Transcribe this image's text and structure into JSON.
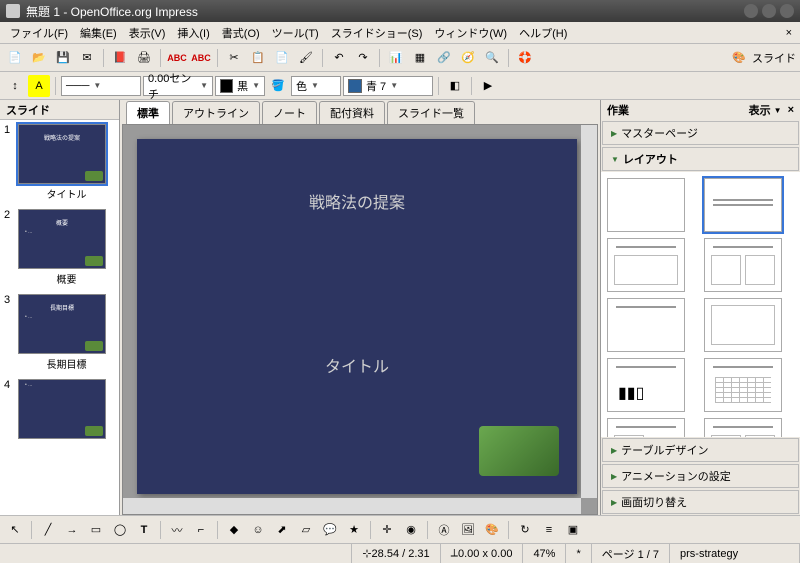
{
  "window": {
    "title": "無題 1 - OpenOffice.org Impress"
  },
  "menus": {
    "file": "ファイル(F)",
    "edit": "編集(E)",
    "view": "表示(V)",
    "insert": "挿入(I)",
    "format": "書式(O)",
    "tools": "ツール(T)",
    "slideshow": "スライドショー(S)",
    "window": "ウィンドウ(W)",
    "help": "ヘルプ(H)"
  },
  "toolbar2": {
    "line_width": "0.00センチ",
    "color1_label": "黒",
    "color2_label": "色",
    "color3_label": "青 7"
  },
  "slide_toggle": "スライド",
  "slide_panel": {
    "title": "スライド"
  },
  "slides": [
    {
      "num": "1",
      "label": "タイトル",
      "title": "戦略法の提案"
    },
    {
      "num": "2",
      "label": "概要",
      "title": "概要"
    },
    {
      "num": "3",
      "label": "長期目標",
      "title": "長期目標"
    },
    {
      "num": "4",
      "label": "",
      "title": ""
    }
  ],
  "view_tabs": {
    "normal": "標準",
    "outline": "アウトライン",
    "notes": "ノート",
    "handout": "配付資料",
    "sorter": "スライド一覧"
  },
  "canvas": {
    "title": "戦略法の提案",
    "subtitle": "タイトル"
  },
  "task_panel": {
    "title": "作業",
    "display": "表示",
    "master": "マスターページ",
    "layout": "レイアウト",
    "table": "テーブルデザイン",
    "animation": "アニメーションの設定",
    "transition": "画面切り替え"
  },
  "status": {
    "pos": "28.54 / 2.31",
    "size": "0.00 x 0.00",
    "zoom": "47%",
    "page": "ページ 1 / 7",
    "template": "prs-strategy"
  }
}
